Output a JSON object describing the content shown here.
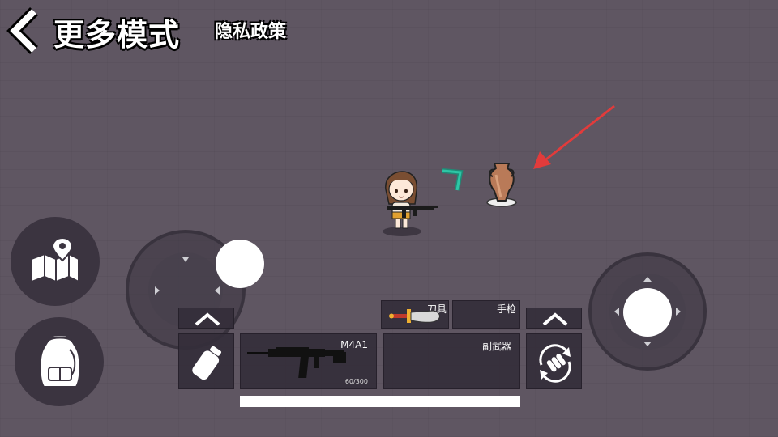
{
  "header": {
    "title": "更多模式",
    "privacy_label": "隐私政策"
  },
  "weapons": {
    "melee_label": "刀具",
    "pistol_label": "手枪",
    "primary_name": "M4A1",
    "primary_ammo": "60/300",
    "secondary_label": "副武器"
  },
  "player": {
    "health_fraction": 1.0
  },
  "icons": {
    "back": "back-chevron-icon",
    "map": "map-icon",
    "backpack": "backpack-icon",
    "medkit": "bottle-icon",
    "swap": "reload-swap-icon",
    "vase": "vase-icon",
    "waypoint": "waypoint-chevron-icon",
    "pointer": "red-arrow-icon"
  },
  "colors": {
    "background": "#5f5662",
    "panel": "#3b3440",
    "waypoint": "#2ec6a6",
    "pointer_arrow": "#e23b3b",
    "knife_handle": "#c0392b",
    "knife_guard": "#f0b030"
  }
}
